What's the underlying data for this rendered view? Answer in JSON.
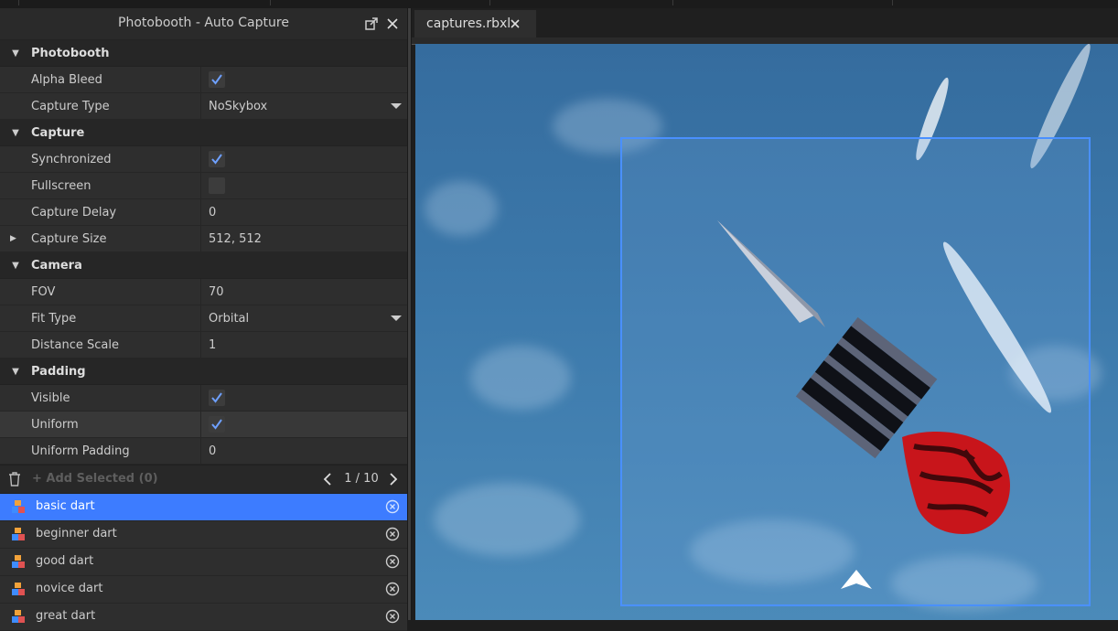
{
  "panel": {
    "title": "Photobooth - Auto Capture",
    "sections": {
      "photobooth": {
        "label": "Photobooth",
        "alpha_bleed": {
          "label": "Alpha Bleed",
          "checked": true
        },
        "capture_type": {
          "label": "Capture Type",
          "value": "NoSkybox"
        }
      },
      "capture": {
        "label": "Capture",
        "synchronized": {
          "label": "Synchronized",
          "checked": true
        },
        "fullscreen": {
          "label": "Fullscreen",
          "checked": false
        },
        "capture_delay": {
          "label": "Capture Delay",
          "value": "0"
        },
        "capture_size": {
          "label": "Capture Size",
          "value": "512, 512"
        }
      },
      "camera": {
        "label": "Camera",
        "fov": {
          "label": "FOV",
          "value": "70"
        },
        "fit_type": {
          "label": "Fit Type",
          "value": "Orbital"
        },
        "distance_scale": {
          "label": "Distance Scale",
          "value": "1"
        }
      },
      "padding": {
        "label": "Padding",
        "visible": {
          "label": "Visible",
          "checked": true
        },
        "uniform": {
          "label": "Uniform",
          "checked": true
        },
        "uniform_padding": {
          "label": "Uniform Padding",
          "value": "0"
        }
      }
    },
    "toolbar": {
      "add_selected": "+ Add Selected (0)",
      "page": "1 / 10"
    },
    "items": [
      {
        "label": "basic dart",
        "selected": true
      },
      {
        "label": "beginner dart",
        "selected": false
      },
      {
        "label": "good dart",
        "selected": false
      },
      {
        "label": "novice dart",
        "selected": false
      },
      {
        "label": "great dart",
        "selected": false
      }
    ]
  },
  "tabs": [
    {
      "label": "captures.rbxl"
    }
  ],
  "colors": {
    "accent": "#3d7cff",
    "capture_frame": "#4a90ff",
    "dart_red": "#c8151b",
    "sky": "#3c79ab"
  }
}
